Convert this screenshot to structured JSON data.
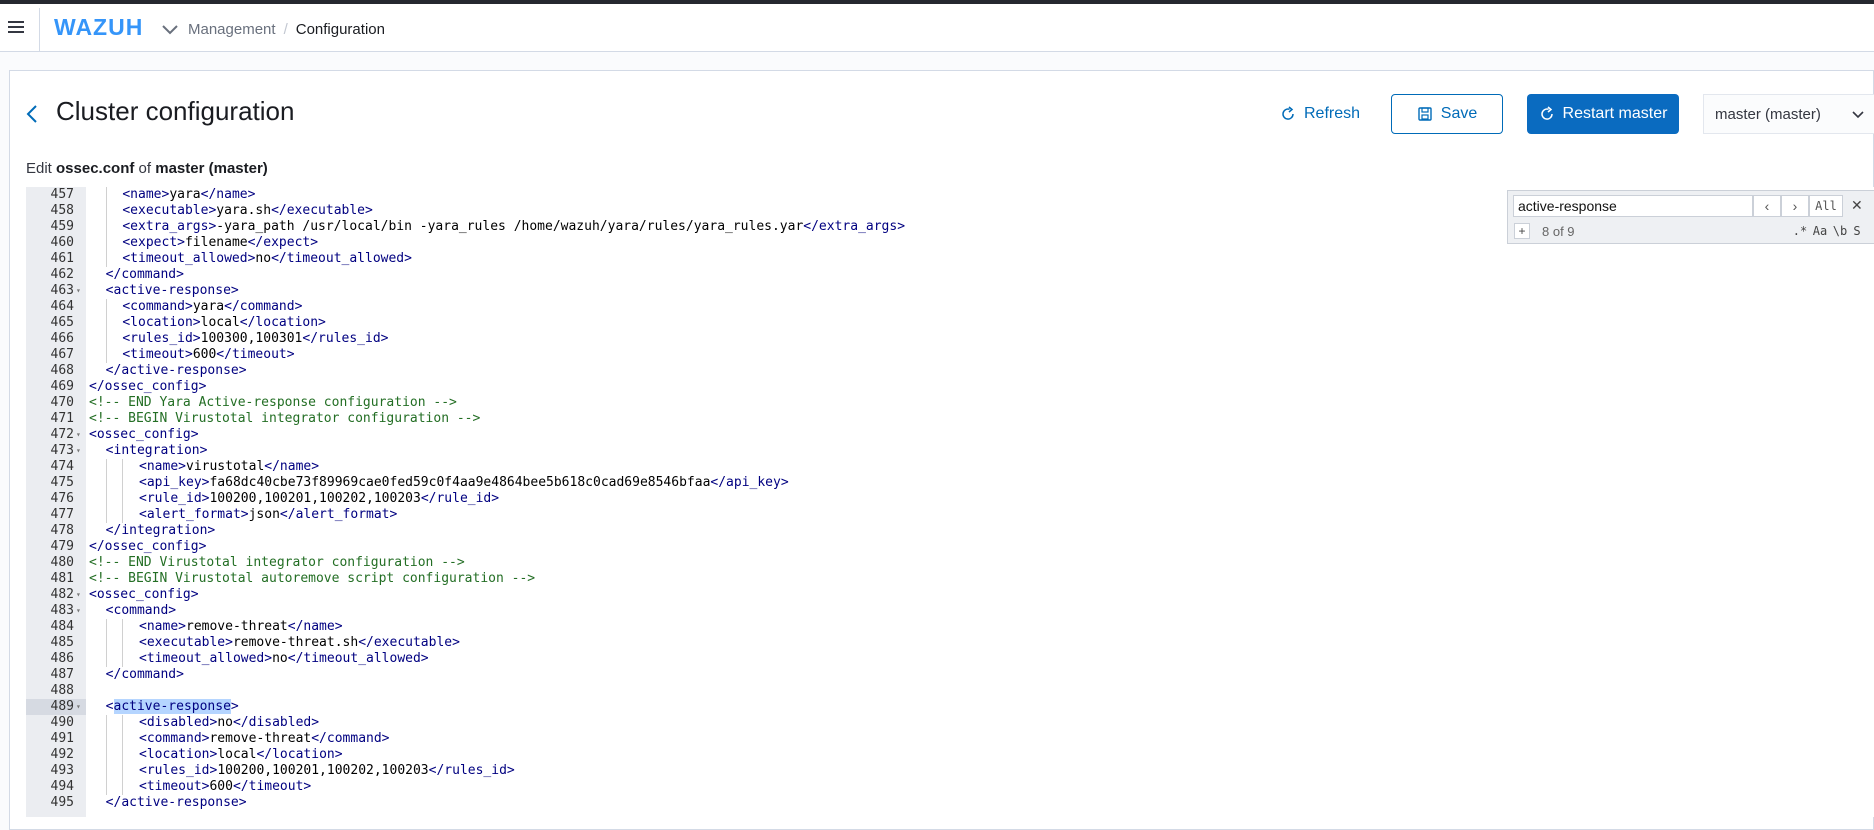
{
  "header": {
    "logo": "WAZUH",
    "breadcrumb": [
      "Management",
      "Configuration"
    ]
  },
  "page": {
    "title": "Cluster configuration",
    "refresh_label": "Refresh",
    "save_label": "Save",
    "restart_label": "Restart master",
    "node_select_value": "master (master)",
    "edit_prefix": "Edit ",
    "edit_file": "ossec.conf",
    "edit_mid": " of ",
    "edit_node": "master (master)"
  },
  "search": {
    "value": "active-response",
    "count": "8 of 9",
    "all_label": "All",
    "options": [
      ".*",
      "Aa",
      "\\b",
      "S"
    ]
  },
  "editor": {
    "active_line": 489,
    "lines": [
      {
        "n": 457,
        "indent": 2,
        "parts": [
          [
            "t",
            "<name>"
          ],
          [
            "x",
            "yara"
          ],
          [
            "t",
            "</name>"
          ]
        ]
      },
      {
        "n": 458,
        "indent": 2,
        "parts": [
          [
            "t",
            "<executable>"
          ],
          [
            "x",
            "yara.sh"
          ],
          [
            "t",
            "</executable>"
          ]
        ]
      },
      {
        "n": 459,
        "indent": 2,
        "parts": [
          [
            "t",
            "<extra_args>"
          ],
          [
            "x",
            "-yara_path /usr/local/bin -yara_rules /home/wazuh/yara/rules/yara_rules.yar"
          ],
          [
            "t",
            "</extra_args>"
          ]
        ]
      },
      {
        "n": 460,
        "indent": 2,
        "parts": [
          [
            "t",
            "<expect>"
          ],
          [
            "x",
            "filename"
          ],
          [
            "t",
            "</expect>"
          ]
        ]
      },
      {
        "n": 461,
        "indent": 2,
        "parts": [
          [
            "t",
            "<timeout_allowed>"
          ],
          [
            "x",
            "no"
          ],
          [
            "t",
            "</timeout_allowed>"
          ]
        ]
      },
      {
        "n": 462,
        "indent": 1,
        "parts": [
          [
            "t",
            "</command>"
          ]
        ]
      },
      {
        "n": 463,
        "indent": 1,
        "fold": true,
        "parts": [
          [
            "t",
            "<active-response>"
          ]
        ]
      },
      {
        "n": 464,
        "indent": 2,
        "parts": [
          [
            "t",
            "<command>"
          ],
          [
            "x",
            "yara"
          ],
          [
            "t",
            "</command>"
          ]
        ]
      },
      {
        "n": 465,
        "indent": 2,
        "parts": [
          [
            "t",
            "<location>"
          ],
          [
            "x",
            "local"
          ],
          [
            "t",
            "</location>"
          ]
        ]
      },
      {
        "n": 466,
        "indent": 2,
        "parts": [
          [
            "t",
            "<rules_id>"
          ],
          [
            "x",
            "100300,100301"
          ],
          [
            "t",
            "</rules_id>"
          ]
        ]
      },
      {
        "n": 467,
        "indent": 2,
        "parts": [
          [
            "t",
            "<timeout>"
          ],
          [
            "x",
            "600"
          ],
          [
            "t",
            "</timeout>"
          ]
        ]
      },
      {
        "n": 468,
        "indent": 1,
        "parts": [
          [
            "t",
            "</active-response>"
          ]
        ]
      },
      {
        "n": 469,
        "indent": 0,
        "parts": [
          [
            "t",
            "</ossec_config>"
          ]
        ]
      },
      {
        "n": 470,
        "indent": 0,
        "parts": [
          [
            "c",
            "<!-- END Yara Active-response configuration -->"
          ]
        ]
      },
      {
        "n": 471,
        "indent": 0,
        "parts": [
          [
            "c",
            "<!-- BEGIN Virustotal integrator configuration -->"
          ]
        ]
      },
      {
        "n": 472,
        "indent": 0,
        "fold": true,
        "parts": [
          [
            "t",
            "<ossec_config>"
          ]
        ]
      },
      {
        "n": 473,
        "indent": 1,
        "fold": true,
        "parts": [
          [
            "t",
            "<integration>"
          ]
        ]
      },
      {
        "n": 474,
        "indent": 3,
        "parts": [
          [
            "t",
            "<name>"
          ],
          [
            "x",
            "virustotal"
          ],
          [
            "t",
            "</name>"
          ]
        ]
      },
      {
        "n": 475,
        "indent": 3,
        "parts": [
          [
            "t",
            "<api_key>"
          ],
          [
            "x",
            "fa68dc40cbe73f89969cae0fed59c0f4aa9e4864bee5b618c0cad69e8546bfaa"
          ],
          [
            "t",
            "</api_key>"
          ]
        ]
      },
      {
        "n": 476,
        "indent": 3,
        "parts": [
          [
            "t",
            "<rule_id>"
          ],
          [
            "x",
            "100200,100201,100202,100203"
          ],
          [
            "t",
            "</rule_id>"
          ]
        ]
      },
      {
        "n": 477,
        "indent": 3,
        "parts": [
          [
            "t",
            "<alert_format>"
          ],
          [
            "x",
            "json"
          ],
          [
            "t",
            "</alert_format>"
          ]
        ]
      },
      {
        "n": 478,
        "indent": 1,
        "parts": [
          [
            "t",
            "</integration>"
          ]
        ]
      },
      {
        "n": 479,
        "indent": 0,
        "parts": [
          [
            "t",
            "</ossec_config>"
          ]
        ]
      },
      {
        "n": 480,
        "indent": 0,
        "parts": [
          [
            "c",
            "<!-- END Virustotal integrator configuration -->"
          ]
        ]
      },
      {
        "n": 481,
        "indent": 0,
        "parts": [
          [
            "c",
            "<!-- BEGIN Virustotal autoremove script configuration -->"
          ]
        ]
      },
      {
        "n": 482,
        "indent": 0,
        "fold": true,
        "parts": [
          [
            "t",
            "<ossec_config>"
          ]
        ]
      },
      {
        "n": 483,
        "indent": 1,
        "fold": true,
        "parts": [
          [
            "t",
            "<command>"
          ]
        ]
      },
      {
        "n": 484,
        "indent": 3,
        "parts": [
          [
            "t",
            "<name>"
          ],
          [
            "x",
            "remove-threat"
          ],
          [
            "t",
            "</name>"
          ]
        ]
      },
      {
        "n": 485,
        "indent": 3,
        "parts": [
          [
            "t",
            "<executable>"
          ],
          [
            "x",
            "remove-threat.sh"
          ],
          [
            "t",
            "</executable>"
          ]
        ]
      },
      {
        "n": 486,
        "indent": 3,
        "parts": [
          [
            "t",
            "<timeout_allowed>"
          ],
          [
            "x",
            "no"
          ],
          [
            "t",
            "</timeout_allowed>"
          ]
        ]
      },
      {
        "n": 487,
        "indent": 1,
        "parts": [
          [
            "t",
            "</command>"
          ]
        ]
      },
      {
        "n": 488,
        "indent": 0,
        "parts": []
      },
      {
        "n": 489,
        "indent": 1,
        "fold": true,
        "parts": [
          [
            "t",
            "<"
          ],
          [
            "h",
            "active-response"
          ],
          [
            "t",
            ">"
          ]
        ]
      },
      {
        "n": 490,
        "indent": 3,
        "parts": [
          [
            "t",
            "<disabled>"
          ],
          [
            "x",
            "no"
          ],
          [
            "t",
            "</disabled>"
          ]
        ]
      },
      {
        "n": 491,
        "indent": 3,
        "parts": [
          [
            "t",
            "<command>"
          ],
          [
            "x",
            "remove-threat"
          ],
          [
            "t",
            "</command>"
          ]
        ]
      },
      {
        "n": 492,
        "indent": 3,
        "parts": [
          [
            "t",
            "<location>"
          ],
          [
            "x",
            "local"
          ],
          [
            "t",
            "</location>"
          ]
        ]
      },
      {
        "n": 493,
        "indent": 3,
        "parts": [
          [
            "t",
            "<rules_id>"
          ],
          [
            "x",
            "100200,100201,100202,100203"
          ],
          [
            "t",
            "</rules_id>"
          ]
        ]
      },
      {
        "n": 494,
        "indent": 3,
        "parts": [
          [
            "t",
            "<timeout>"
          ],
          [
            "x",
            "600"
          ],
          [
            "t",
            "</timeout>"
          ]
        ]
      },
      {
        "n": 495,
        "indent": 1,
        "parts": [
          [
            "t",
            "</active-response>"
          ]
        ]
      }
    ]
  }
}
